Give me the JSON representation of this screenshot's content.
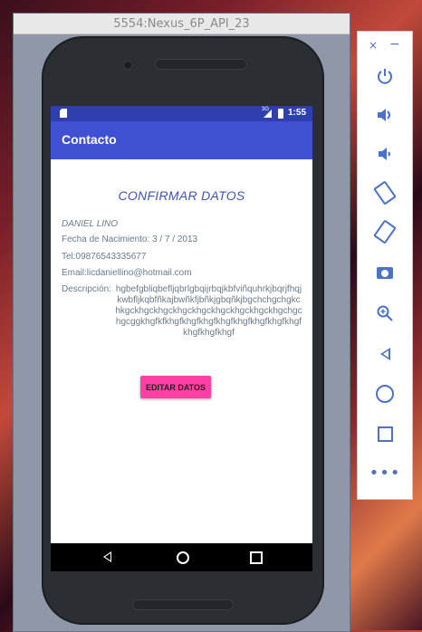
{
  "window": {
    "title": "5554:Nexus_6P_API_23"
  },
  "status_bar": {
    "network": "3G",
    "time": "1:55"
  },
  "app_bar": {
    "title": "Contacto"
  },
  "content": {
    "heading": "CONFIRMAR DATOS",
    "name": "DANIEL LINO",
    "birth_date": "Fecha de Nacimiento: 3 / 7 / 2013",
    "phone": "Tel:09876543335677",
    "email": "Email:licdaniellino@hotmail.com",
    "description_label": "Descripción:",
    "description_text": "hgbefgbliqbefljqbrlgbqijrbqjkbfviñquhrkjbqrjfhqjkwbfljkqbfñkajbwñkfjbñkjgbqñkjbgchchgchgkchkgckhgckhgckhgckhgckhgckhgckhgckhgchgchgcggkhgfkfkhgfkhgfkhgfkhgfkhgfkhgfkhgfkhgfkhgfkhgfkhgf",
    "edit_button": "EDITAR DATOS"
  },
  "toolbar": {
    "close": "×",
    "minimize": "−",
    "buttons": [
      "power-icon",
      "volume-up-icon",
      "volume-down-icon",
      "rotate-left-icon",
      "rotate-right-icon",
      "camera-icon",
      "zoom-icon",
      "back-icon",
      "home-icon",
      "overview-icon",
      "more-icon"
    ]
  },
  "colors": {
    "accent": "#3f51d2",
    "status_bar": "#2f3fb0",
    "button": "#ff3fa6",
    "heading": "#3f51b5",
    "toolbar_icon": "#4a72c9"
  }
}
